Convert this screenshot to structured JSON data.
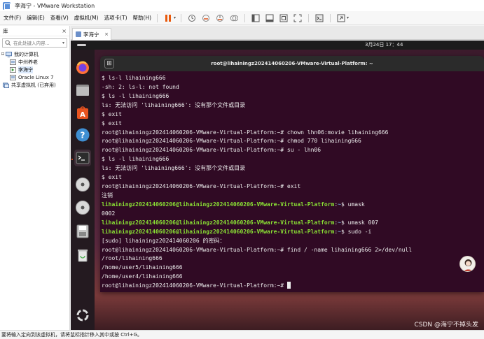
{
  "window": {
    "title": "李海宁 - VMware Workstation"
  },
  "menu": {
    "items": [
      "文件(F)",
      "编辑(E)",
      "查看(V)",
      "虚拟机(M)",
      "选项卡(T)",
      "帮助(H)"
    ]
  },
  "toolbar": {
    "icons": [
      "pause-icon",
      "snapshot-icon",
      "revert-snapshot-icon",
      "manage-snapshots-icon",
      "show-library-icon",
      "thumbnail-icon",
      "fit-guest-icon",
      "full-screen-icon",
      "console-view-icon",
      "stretch-icon"
    ]
  },
  "library": {
    "header": "库",
    "close": "×",
    "search_placeholder": "在此处键入内容...",
    "tree": [
      {
        "label": "我的计算机",
        "level": 0,
        "icon": "computer-icon"
      },
      {
        "label": "中州养老",
        "level": 1,
        "icon": "vm-icon"
      },
      {
        "label": "李海宁",
        "level": 1,
        "icon": "vm-running-icon",
        "selected": true
      },
      {
        "label": "Oracle Linux 7",
        "level": 1,
        "icon": "vm-icon"
      },
      {
        "label": "共享虚拟机 (已弃用)",
        "level": 0,
        "icon": "shared-vms-icon"
      }
    ]
  },
  "tabs": [
    {
      "label": "李海宁",
      "close": "×"
    }
  ],
  "vm": {
    "clock": "3月24日  17：44",
    "terminal_title": "root@lihainingz202414060206-VMware-Virtual-Platform: ~",
    "prompt_user": "lihainingz202414060206@lihainingz202414060206-VMware-Virtual-Platform",
    "lines": [
      {
        "text": "$ ls-l lihaining666"
      },
      {
        "text": "-sh: 2: ls-l: not found"
      },
      {
        "text": "$ ls -l lihaining666"
      },
      {
        "text": "ls: 无法访问 'lihaining666': 没有那个文件或目录"
      },
      {
        "text": "$ exit"
      },
      {
        "text": "$ exit"
      },
      {
        "text": "root@lihainingz202414060206-VMware-Virtual-Platform:~# chown lhn06:movie lihaining666"
      },
      {
        "text": "root@lihainingz202414060206-VMware-Virtual-Platform:~# chmod 770 lihaining666"
      },
      {
        "text": "root@lihainingz202414060206-VMware-Virtual-Platform:~# su - lhn06"
      },
      {
        "text": "$ ls -l lihaining666"
      },
      {
        "text": "ls: 无法访问 'lihaining666': 没有那个文件或目录"
      },
      {
        "text": "$ exit"
      },
      {
        "text": "root@lihainingz202414060206-VMware-Virtual-Platform:~# exit"
      },
      {
        "text": "注销"
      },
      {
        "prompt": true,
        "cmd": "$ umask"
      },
      {
        "text": "0002"
      },
      {
        "prompt": true,
        "cmd": "$ umask 007"
      },
      {
        "prompt": true,
        "cmd": "$ sudo -i"
      },
      {
        "text": "[sudo] lihainingz202414060206 的密码："
      },
      {
        "text": "root@lihainingz202414060206-VMware-Virtual-Platform:~# find / -name lihaining666 2>/dev/null"
      },
      {
        "text": "/root/lihaining666"
      },
      {
        "text": "/home/user5/lihaining666"
      },
      {
        "text": "/home/user4/lihaining666"
      },
      {
        "text": "root@lihainingz202414060206-VMware-Virtual-Platform:~# ",
        "cursor": true
      }
    ],
    "dock": [
      "firefox-icon",
      "files-icon",
      "app-center-icon",
      "help-icon",
      "terminal-icon",
      "disc-icon",
      "disc-icon",
      "save-icon",
      "trash-icon",
      "show-apps-icon"
    ]
  },
  "watermark": "CSDN @海宁不掉头发",
  "statusbar": "要将输入定向到该虚拟机，请将鼠标指针移入其中或按 Ctrl+G。"
}
